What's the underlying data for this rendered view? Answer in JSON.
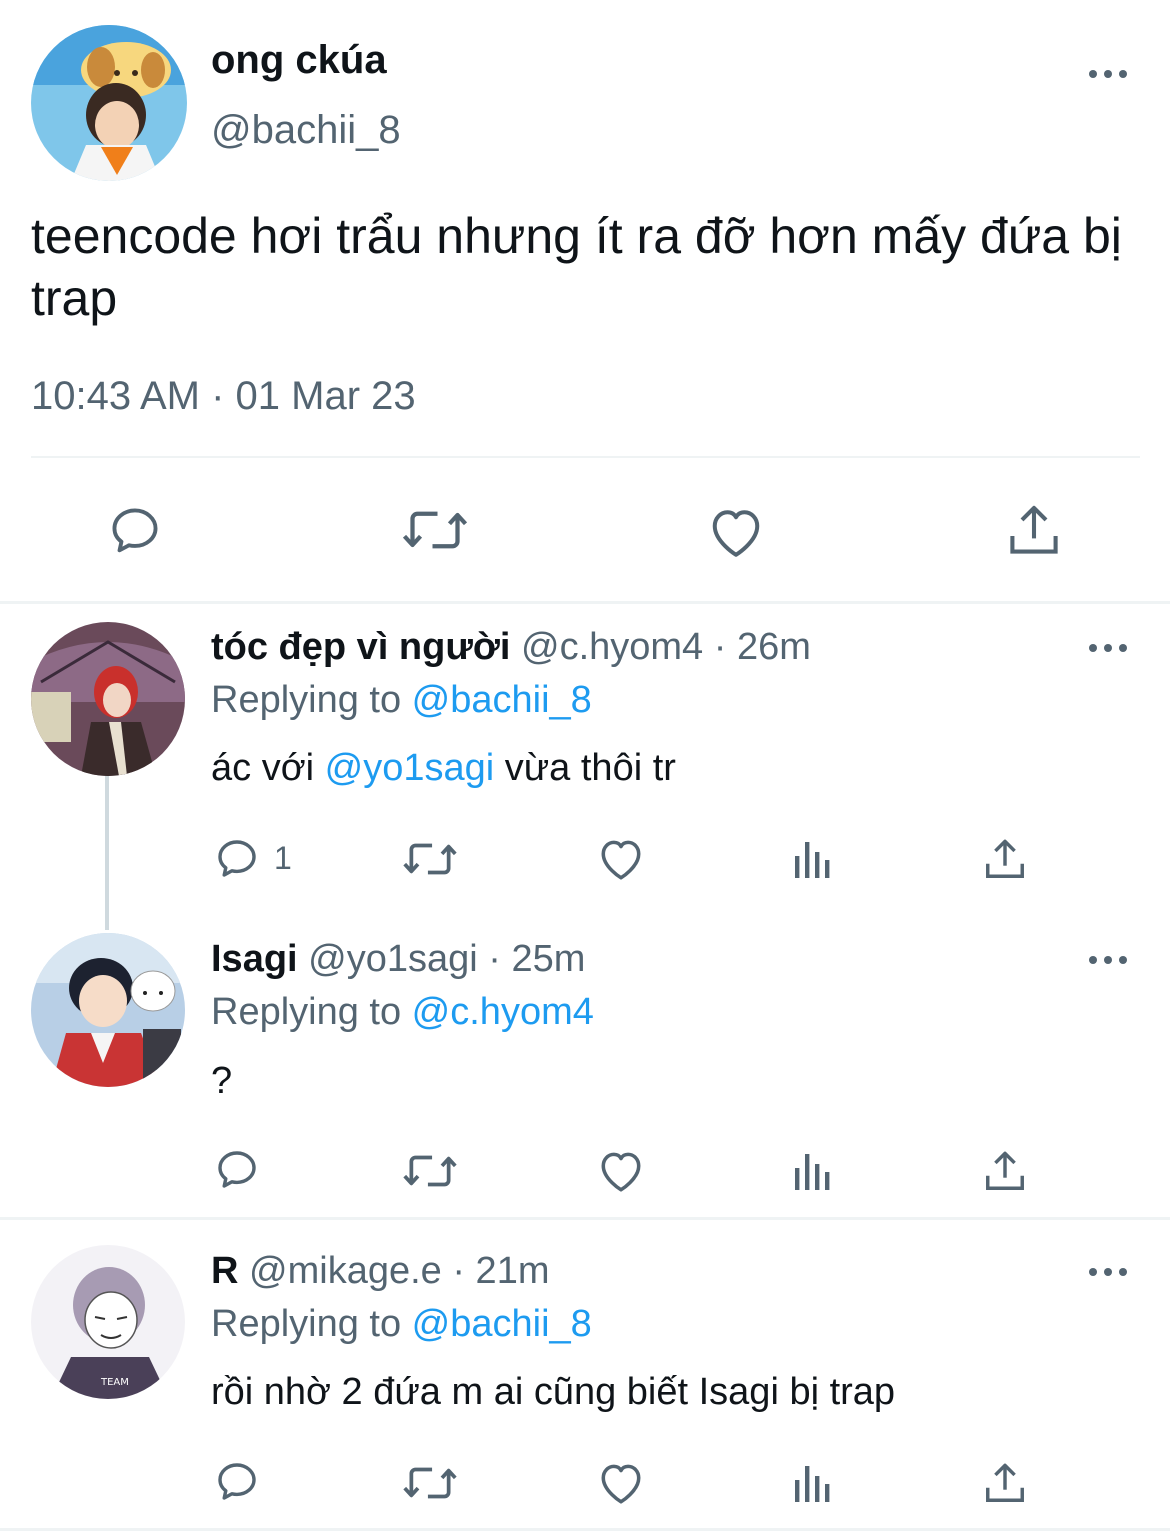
{
  "main_tweet": {
    "name": "ong ckúa",
    "handle": "@bachii_8",
    "text": "teencode hơi trẩu nhưng ít ra đỡ hơn mấy đứa bị trap",
    "timestamp": "10:43 AM · 01 Mar 23",
    "actions": [
      "reply-icon",
      "retweet-icon",
      "like-icon",
      "share-icon"
    ]
  },
  "replies": [
    {
      "name": "tóc đẹp vì người",
      "handle": "@c.hyom4",
      "time": "· 26m",
      "replying_prefix": "Replying to ",
      "replying_to": "@bachii_8",
      "text_before": "ác với ",
      "text_mention": "@yo1sagi",
      "text_after": " vừa thôi tr",
      "reply_count": "1"
    },
    {
      "name": "Isagi",
      "handle": "@yo1sagi",
      "time": "· 25m",
      "replying_prefix": "Replying to ",
      "replying_to": "@c.hyom4",
      "text": "?"
    },
    {
      "name": "R",
      "handle": "@mikage.e",
      "time": "· 21m",
      "replying_prefix": "Replying to ",
      "replying_to": "@bachii_8",
      "text": "rồi nhờ 2 đứa m ai cũng biết Isagi bị trap"
    }
  ],
  "colors": {
    "text": "#0f1419",
    "secondary": "#536471",
    "link": "#1d9bf0",
    "divider": "#eff3f4"
  }
}
